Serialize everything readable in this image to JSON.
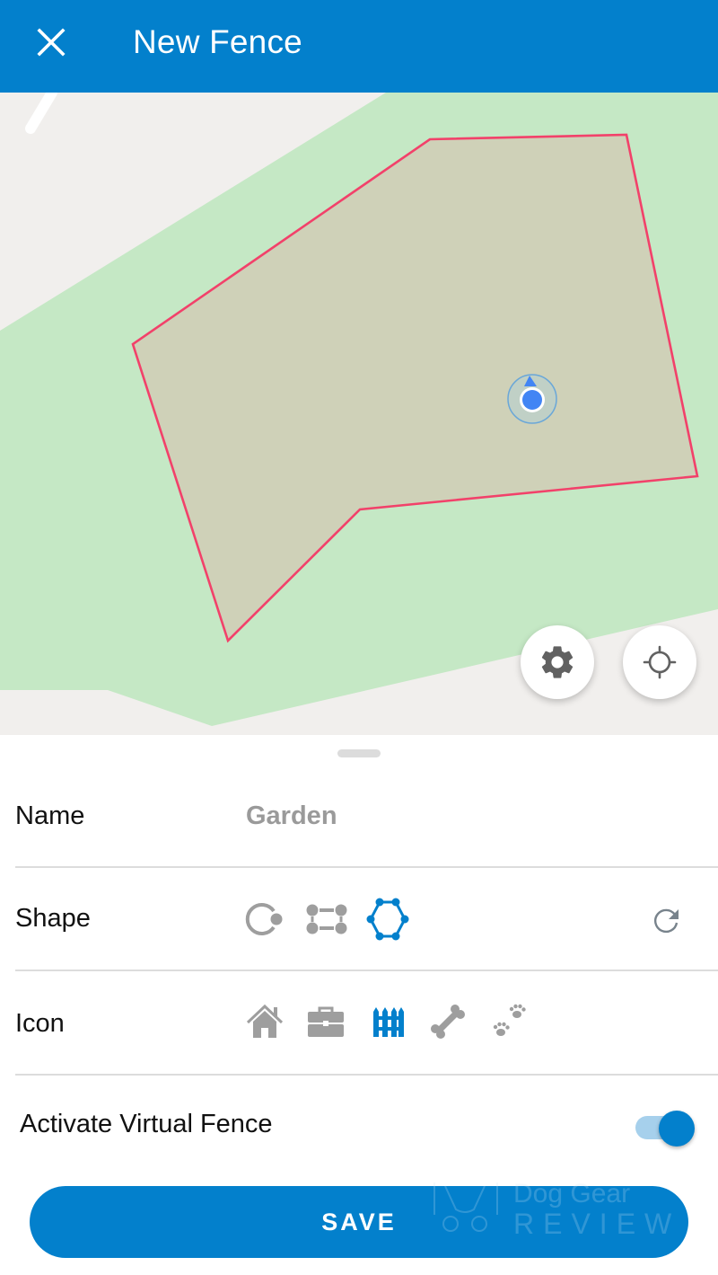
{
  "appbar": {
    "title": "New Fence",
    "close_icon": "close-icon"
  },
  "map": {
    "fence_color": "#f2416a",
    "fence_fill": "#cfd1b8",
    "park_color": "#c5e8c5",
    "land_color": "#f1efed",
    "location_dot_color": "#4285f4",
    "settings_icon": "gear-icon",
    "locate_icon": "crosshair-icon"
  },
  "form": {
    "name": {
      "label": "Name",
      "value": "Garden"
    },
    "shape": {
      "label": "Shape",
      "options": [
        {
          "icon": "circle-shape-icon",
          "selected": false
        },
        {
          "icon": "rectangle-shape-icon",
          "selected": false
        },
        {
          "icon": "polygon-shape-icon",
          "selected": true
        }
      ],
      "reset_icon": "redo-icon"
    },
    "icon": {
      "label": "Icon",
      "options": [
        {
          "icon": "house-icon",
          "selected": false
        },
        {
          "icon": "briefcase-icon",
          "selected": false
        },
        {
          "icon": "fence-icon",
          "selected": true
        },
        {
          "icon": "bone-icon",
          "selected": false
        },
        {
          "icon": "paw-prints-icon",
          "selected": false
        }
      ]
    },
    "activate": {
      "label": "Activate Virtual Fence",
      "enabled": true
    }
  },
  "save_label": "SAVE",
  "watermark": {
    "line1": "Dog Gear",
    "line2": "REVIEW"
  },
  "colors": {
    "primary": "#0380cc",
    "inactive_icon": "#9e9e9e",
    "toggle_track": "#a6d0ec"
  }
}
